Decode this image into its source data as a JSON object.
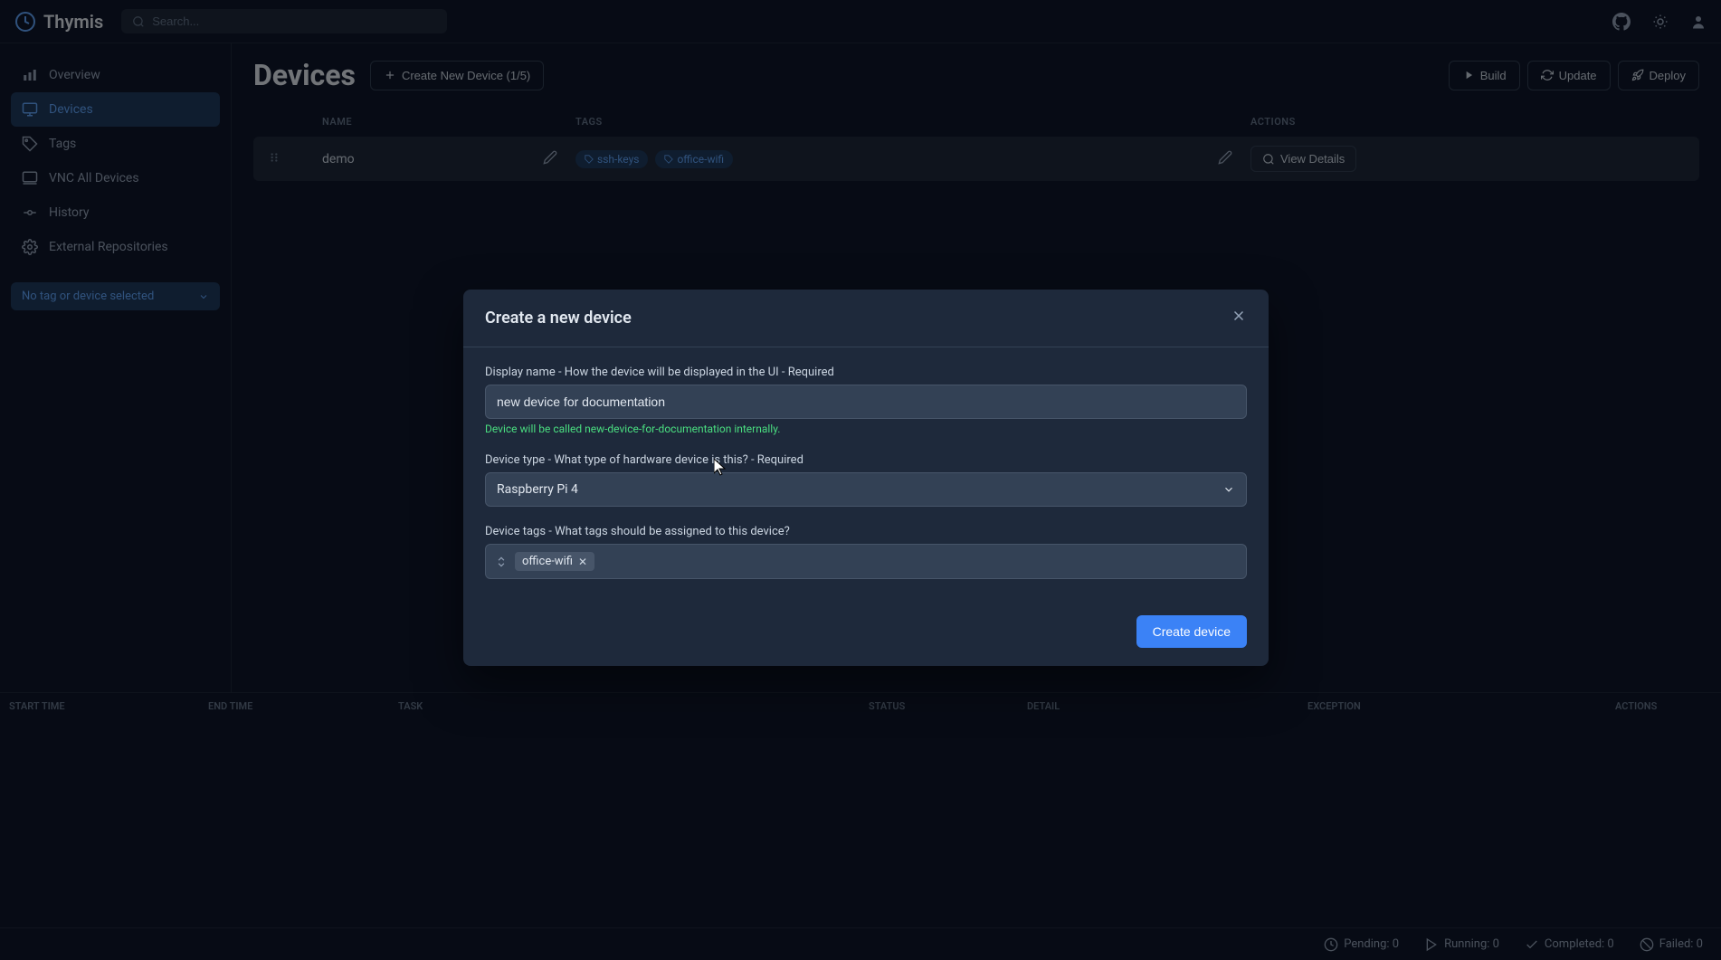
{
  "header": {
    "app_name": "Thymis",
    "search_placeholder": "Search..."
  },
  "sidebar": {
    "items": [
      {
        "label": "Overview"
      },
      {
        "label": "Devices"
      },
      {
        "label": "Tags"
      },
      {
        "label": "VNC All Devices"
      },
      {
        "label": "History"
      },
      {
        "label": "External Repositories"
      }
    ],
    "selector_label": "No tag or device selected"
  },
  "page": {
    "title": "Devices",
    "create_label": "Create New Device (1/5)",
    "build_label": "Build",
    "update_label": "Update",
    "deploy_label": "Deploy"
  },
  "table": {
    "col_name": "NAME",
    "col_tags": "TAGS",
    "col_actions": "ACTIONS",
    "rows": [
      {
        "name": "demo",
        "tags": [
          "ssh-keys",
          "office-wifi"
        ],
        "view_details": "View Details"
      }
    ]
  },
  "modal": {
    "title": "Create a new device",
    "field_name_label": "Display name - How the device will be displayed in the UI - Required",
    "field_name_value": "new device for documentation",
    "field_name_hint": "Device will be called new-device-for-documentation internally.",
    "field_type_label": "Device type - What type of hardware device is this? - Required",
    "field_type_value": "Raspberry Pi 4",
    "field_tags_label": "Device tags - What tags should be assigned to this device?",
    "field_tags_selected": "office-wifi",
    "submit_label": "Create device"
  },
  "task_panel": {
    "col_start": "START TIME",
    "col_end": "END TIME",
    "col_task": "TASK",
    "col_status": "STATUS",
    "col_detail": "DETAIL",
    "col_exception": "EXCEPTION",
    "col_actions": "ACTIONS"
  },
  "footer": {
    "pending": "Pending: 0",
    "running": "Running: 0",
    "completed": "Completed: 0",
    "failed": "Failed: 0"
  }
}
